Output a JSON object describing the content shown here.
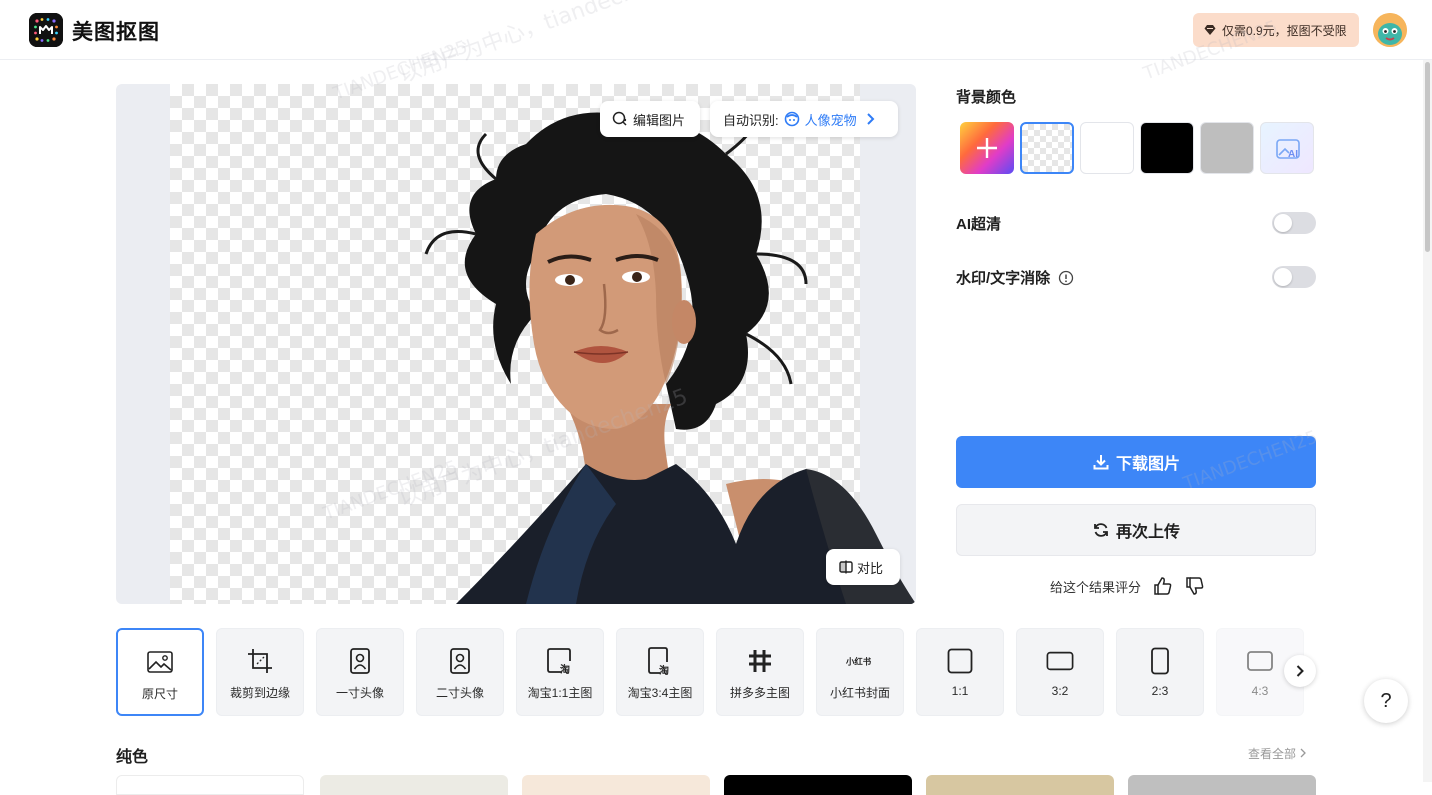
{
  "header": {
    "app_title": "美图抠图",
    "promo_text": "仅需0.9元，抠图不受限"
  },
  "canvas": {
    "edit_label": "编辑图片",
    "auto_detect_label": "自动识别:",
    "auto_detect_value": "人像宠物",
    "compare_label": "对比"
  },
  "panel": {
    "bg_color_title": "背景颜色",
    "ai_sharpen_label": "AI超清",
    "watermark_remove_label": "水印/文字消除",
    "download_label": "下载图片",
    "reupload_label": "再次上传",
    "rate_label": "给这个结果评分"
  },
  "sizes": [
    {
      "label": "原尺寸"
    },
    {
      "label": "裁剪到边缘"
    },
    {
      "label": "一寸头像"
    },
    {
      "label": "二寸头像"
    },
    {
      "label": "淘宝1:1主图"
    },
    {
      "label": "淘宝3:4主图"
    },
    {
      "label": "拼多多主图"
    },
    {
      "label": "小红书封面"
    },
    {
      "label": "1:1"
    },
    {
      "label": "3:2"
    },
    {
      "label": "2:3"
    },
    {
      "label": "4:3"
    }
  ],
  "presets": {
    "section_title": "纯色",
    "view_all": "查看全部"
  },
  "watermark_texts": [
    "以用户为中心，tiandechen25",
    "TIANDECHEN25"
  ],
  "icons": {
    "xiaohongshu_glyph": "小红书",
    "taobao_glyph": "淘",
    "pdd_glyph": "拼"
  },
  "colors": {
    "accent": "#3d86f7",
    "promo_bg": "#fbdcca",
    "swatch_white": "#ffffff",
    "swatch_black": "#000000",
    "swatch_gray": "#bebebe"
  },
  "help_label": "?"
}
